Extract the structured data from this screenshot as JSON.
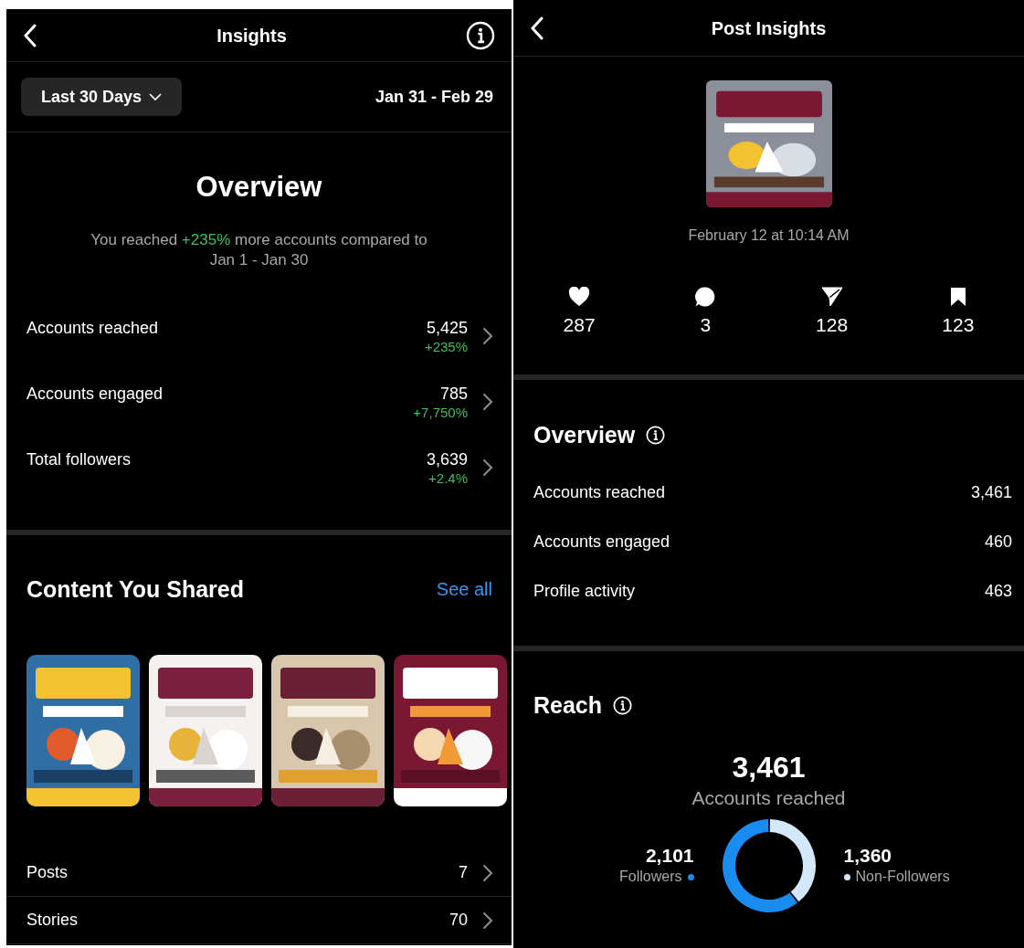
{
  "left": {
    "header": {
      "title": "Insights"
    },
    "range": {
      "label": "Last 30 Days",
      "dates": "Jan 31 - Feb 29"
    },
    "overview": {
      "title": "Overview",
      "summary": "You reached **+235%** more accounts compared to Jan 1 - Jan 30",
      "metrics": [
        {
          "label": "Accounts reached",
          "value": "5,425",
          "change": "+235%"
        },
        {
          "label": "Accounts engaged",
          "value": "785",
          "change": "+7,750%"
        },
        {
          "label": "Total followers",
          "value": "3,639",
          "change": "+2.4%"
        }
      ]
    },
    "content": {
      "title": "Content You Shared",
      "link": "See all",
      "rows": [
        {
          "label": "Posts",
          "value": "7"
        },
        {
          "label": "Stories",
          "value": "70"
        }
      ]
    }
  },
  "right": {
    "header": {
      "title": "Post Insights"
    },
    "post": {
      "date": "February 12 at 10:14 AM"
    },
    "stats": [
      {
        "kind": "likes",
        "value": "287"
      },
      {
        "kind": "comments",
        "value": "3"
      },
      {
        "kind": "shares",
        "value": "128"
      },
      {
        "kind": "saves",
        "value": "123"
      }
    ],
    "overview": {
      "title": "Overview",
      "rows": [
        {
          "label": "Accounts reached",
          "value": "3,461"
        },
        {
          "label": "Accounts engaged",
          "value": "460"
        },
        {
          "label": "Profile activity",
          "value": "463"
        }
      ]
    },
    "reach": {
      "title": "Reach",
      "total": "3,461",
      "total_label": "Accounts reached",
      "legend": [
        {
          "value": "2,101",
          "color": "#1a8cf0"
        },
        {
          "value": "1,360",
          "color": "#d4e8fb"
        }
      ],
      "chart_data": {
        "type": "donut",
        "categories": [
          "Followers",
          "Non-Followers"
        ],
        "values": [
          60.7,
          39.3
        ]
      }
    }
  }
}
